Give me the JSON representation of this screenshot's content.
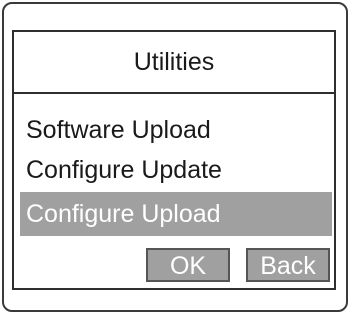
{
  "dialog": {
    "title": "Utilities",
    "menu_items": [
      {
        "label": "Software Upload",
        "selected": false
      },
      {
        "label": "Configure Update",
        "selected": false
      },
      {
        "label": "Configure Upload",
        "selected": true
      }
    ],
    "ok_label": "OK",
    "back_label": "Back"
  },
  "colors": {
    "selection": "#a0a0a0",
    "border": "#2e2e2e",
    "text": "#1a1a1a"
  }
}
